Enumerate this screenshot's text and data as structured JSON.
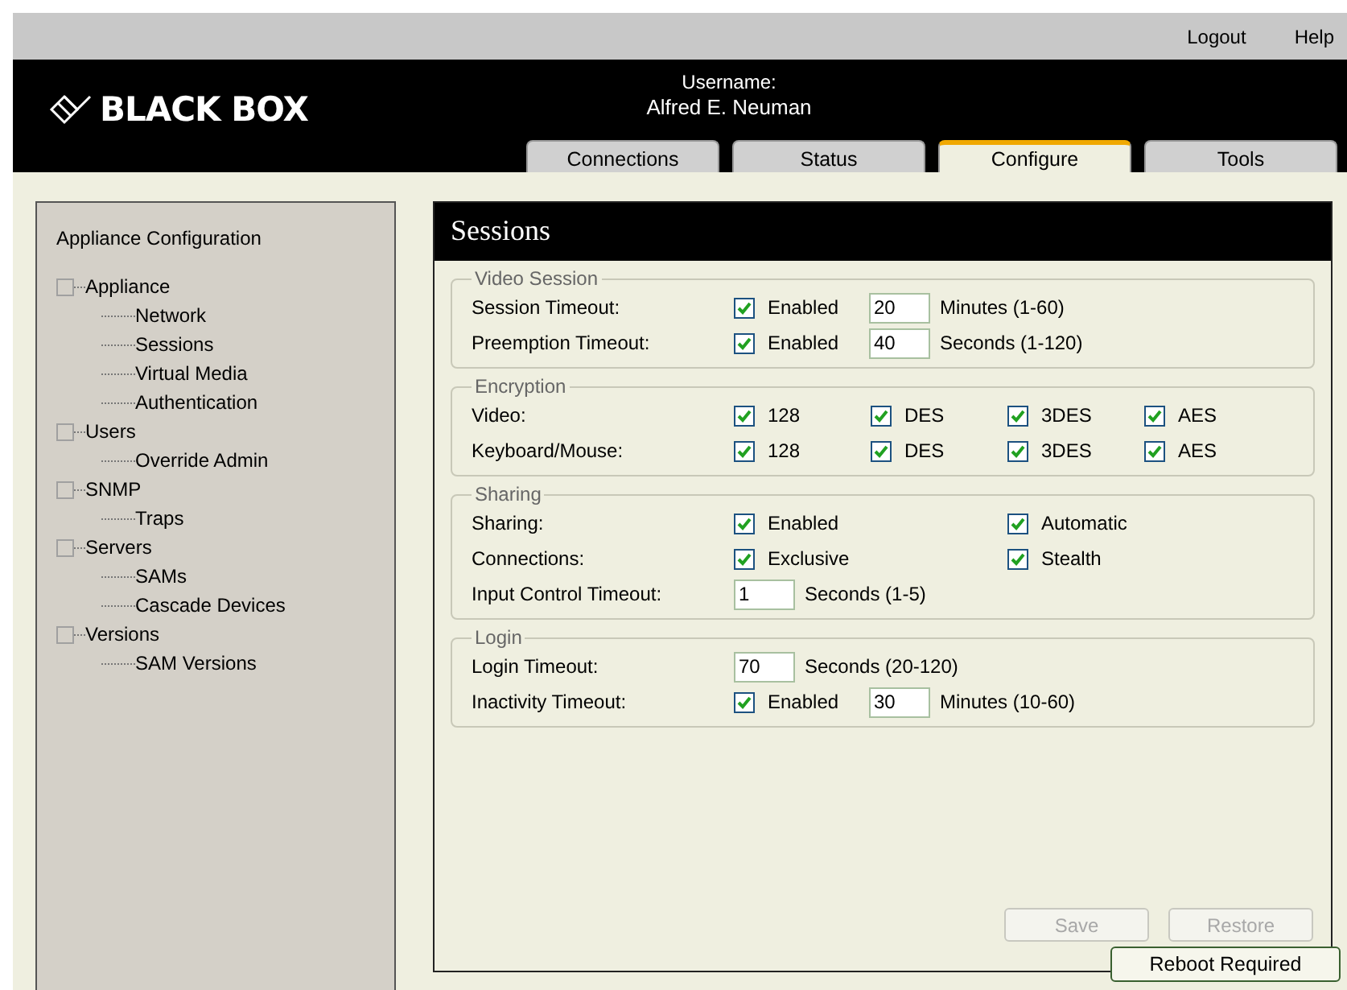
{
  "top_links": [
    "Logout",
    "Help"
  ],
  "logo": "BLACK BOX",
  "user": {
    "label": "Username:",
    "name": "Alfred E. Neuman"
  },
  "tabs": [
    {
      "label": "Connections",
      "selected": false
    },
    {
      "label": "Status",
      "selected": false
    },
    {
      "label": "Configure",
      "selected": true
    },
    {
      "label": "Tools",
      "selected": false
    }
  ],
  "sidebar": {
    "title": "Appliance Configuration",
    "tree": [
      {
        "label": "Appliance",
        "children": [
          {
            "label": "Network"
          },
          {
            "label": "Sessions"
          },
          {
            "label": "Virtual Media"
          },
          {
            "label": "Authentication"
          }
        ]
      },
      {
        "label": "Users",
        "children": [
          {
            "label": "Override Admin"
          }
        ]
      },
      {
        "label": "SNMP",
        "children": [
          {
            "label": "Traps"
          }
        ]
      },
      {
        "label": "Servers",
        "children": [
          {
            "label": "SAMs"
          },
          {
            "label": "Cascade Devices"
          }
        ]
      },
      {
        "label": "Versions",
        "children": [
          {
            "label": "SAM Versions"
          }
        ]
      }
    ]
  },
  "panel": {
    "title": "Sessions",
    "groups": [
      {
        "legend": "Video Session",
        "rows": [
          {
            "label": "Session Timeout:",
            "cells": [
              {
                "kind": "checkbox",
                "text": "Enabled",
                "checked": true
              },
              {
                "kind": "field",
                "value": "20"
              },
              {
                "kind": "note",
                "text": "Minutes (1-60)"
              }
            ]
          },
          {
            "label": "Preemption Timeout:",
            "cells": [
              {
                "kind": "checkbox",
                "text": "Enabled",
                "checked": true
              },
              {
                "kind": "field",
                "value": "40"
              },
              {
                "kind": "note",
                "text": "Seconds (1-120)"
              }
            ]
          }
        ]
      },
      {
        "legend": "Encryption",
        "rows": [
          {
            "label": "Video:",
            "cells": [
              {
                "kind": "checkbox",
                "text": "128",
                "checked": true
              },
              {
                "kind": "checkbox",
                "text": "DES",
                "checked": true
              },
              {
                "kind": "checkbox",
                "text": "3DES",
                "checked": true
              },
              {
                "kind": "checkbox",
                "text": "AES",
                "checked": true
              }
            ]
          },
          {
            "label": "Keyboard/Mouse:",
            "cells": [
              {
                "kind": "checkbox",
                "text": "128",
                "checked": true
              },
              {
                "kind": "checkbox",
                "text": "DES",
                "checked": true
              },
              {
                "kind": "checkbox",
                "text": "3DES",
                "checked": true
              },
              {
                "kind": "checkbox",
                "text": "AES",
                "checked": true
              }
            ]
          }
        ]
      },
      {
        "legend": "Sharing",
        "rows": [
          {
            "label": "Sharing:",
            "cells": [
              {
                "kind": "checkbox",
                "text": "Enabled",
                "checked": true
              },
              {
                "kind": "checkbox",
                "text": "Automatic",
                "checked": true
              }
            ]
          },
          {
            "label": "Connections:",
            "cells": [
              {
                "kind": "checkbox",
                "text": "Exclusive",
                "checked": true
              },
              {
                "kind": "checkbox",
                "text": "Stealth",
                "checked": true
              }
            ]
          },
          {
            "label": "Input Control Timeout:",
            "cells": [
              {
                "kind": "field",
                "value": "1"
              },
              {
                "kind": "note",
                "text": "Seconds (1-5)"
              }
            ]
          }
        ]
      },
      {
        "legend": "Login",
        "rows": [
          {
            "label": "Login Timeout:",
            "cells": [
              {
                "kind": "field",
                "value": "70"
              },
              {
                "kind": "note",
                "text": "Seconds (20-120)"
              }
            ]
          },
          {
            "label": "Inactivity Timeout:",
            "cells": [
              {
                "kind": "checkbox",
                "text": "Enabled",
                "checked": true
              },
              {
                "kind": "field",
                "value": "30"
              },
              {
                "kind": "note",
                "text": "Minutes (10-60)"
              }
            ]
          }
        ]
      }
    ],
    "buttons": [
      {
        "label": "Save",
        "disabled": true
      },
      {
        "label": "Restore",
        "disabled": true
      }
    ]
  },
  "footer_button": "Reboot Required"
}
